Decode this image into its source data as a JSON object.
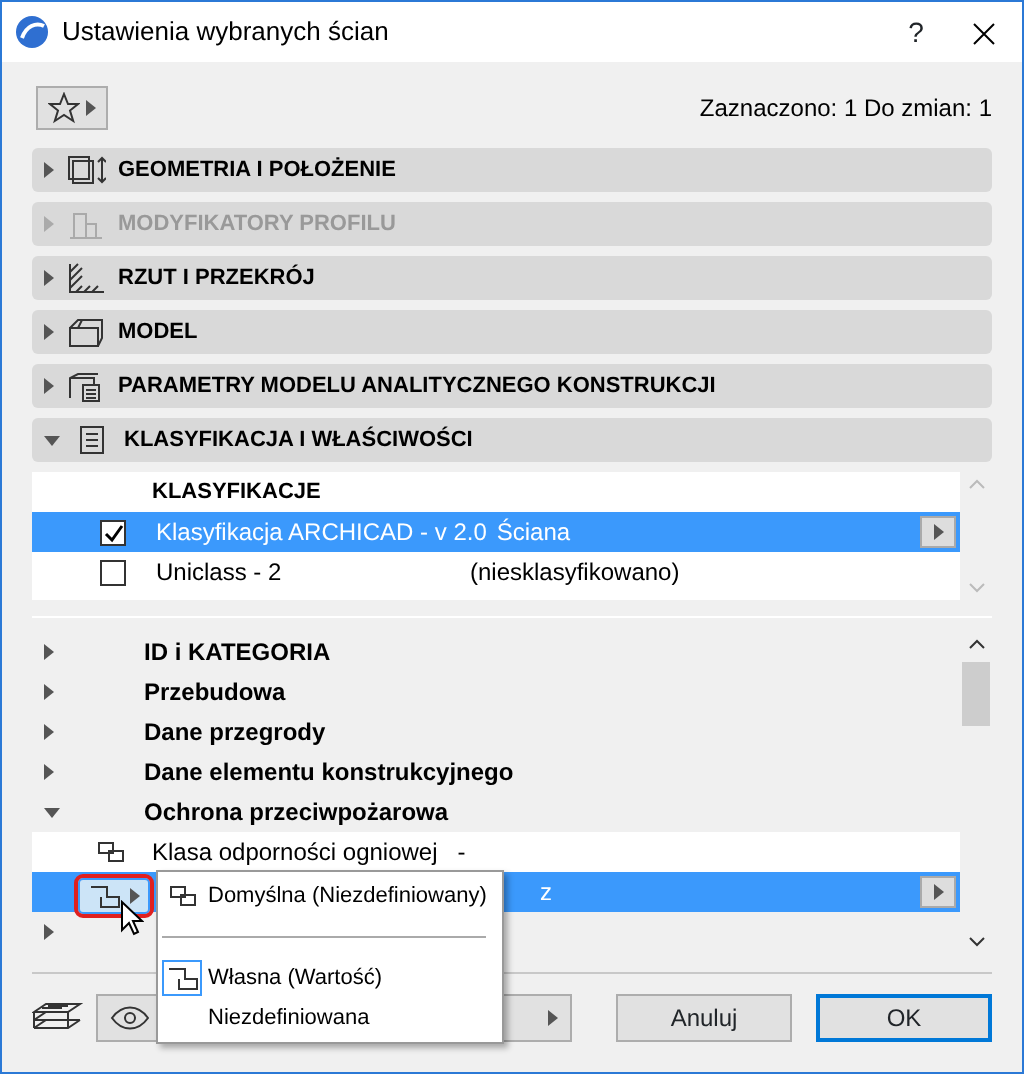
{
  "window": {
    "title": "Ustawienia wybranych ścian",
    "help": "?"
  },
  "selection_info": "Zaznaczono: 1 Do zmian: 1",
  "sections": [
    {
      "label": "GEOMETRIA I POŁOŻENIE",
      "expanded": false,
      "disabled": false
    },
    {
      "label": "MODYFIKATORY PROFILU",
      "expanded": false,
      "disabled": true
    },
    {
      "label": "RZUT I PRZEKRÓJ",
      "expanded": false,
      "disabled": false
    },
    {
      "label": "MODEL",
      "expanded": false,
      "disabled": false
    },
    {
      "label": "PARAMETRY MODELU ANALITYCZNEGO KONSTRUKCJI",
      "expanded": false,
      "disabled": false
    },
    {
      "label": "KLASYFIKACJA I WŁAŚCIWOŚCI",
      "expanded": true,
      "disabled": false
    }
  ],
  "classification": {
    "header": "KLASYFIKACJE",
    "rows": [
      {
        "checked": true,
        "selected": true,
        "name": "Klasyfikacja ARCHICAD - v 2.0",
        "value": "Ściana"
      },
      {
        "checked": false,
        "selected": false,
        "name": "Uniclass - 2",
        "value": "(niesklasyfikowano)"
      }
    ]
  },
  "properties": [
    {
      "kind": "group",
      "label": "ID i KATEGORIA",
      "expanded": false
    },
    {
      "kind": "group",
      "label": "Przebudowa",
      "expanded": false
    },
    {
      "kind": "group",
      "label": "Dane przegrody",
      "expanded": false
    },
    {
      "kind": "group",
      "label": "Dane elementu konstrukcyjnego",
      "expanded": false
    },
    {
      "kind": "group",
      "label": "Ochrona przeciwpożarowa",
      "expanded": true,
      "children": [
        {
          "kind": "property",
          "label": "Klasa odporności ogniowej",
          "value": "-",
          "selected": false
        },
        {
          "kind": "property",
          "value": "z",
          "selected": true
        }
      ]
    },
    {
      "kind": "group",
      "expanded": false
    }
  ],
  "value_menu": {
    "items": [
      {
        "kind": "item",
        "label": "Domyślna (Niezdefiniowany)",
        "icon": true,
        "selected": false
      },
      {
        "kind": "separator"
      },
      {
        "kind": "item",
        "label": "Własna (Wartość)",
        "icon": true,
        "selected": true
      },
      {
        "kind": "item",
        "label": "Niezdefiniowana",
        "icon": false,
        "selected": false
      }
    ]
  },
  "buttons": [
    {
      "label": "Anuluj",
      "default": false
    },
    {
      "label": "OK",
      "default": true
    }
  ]
}
